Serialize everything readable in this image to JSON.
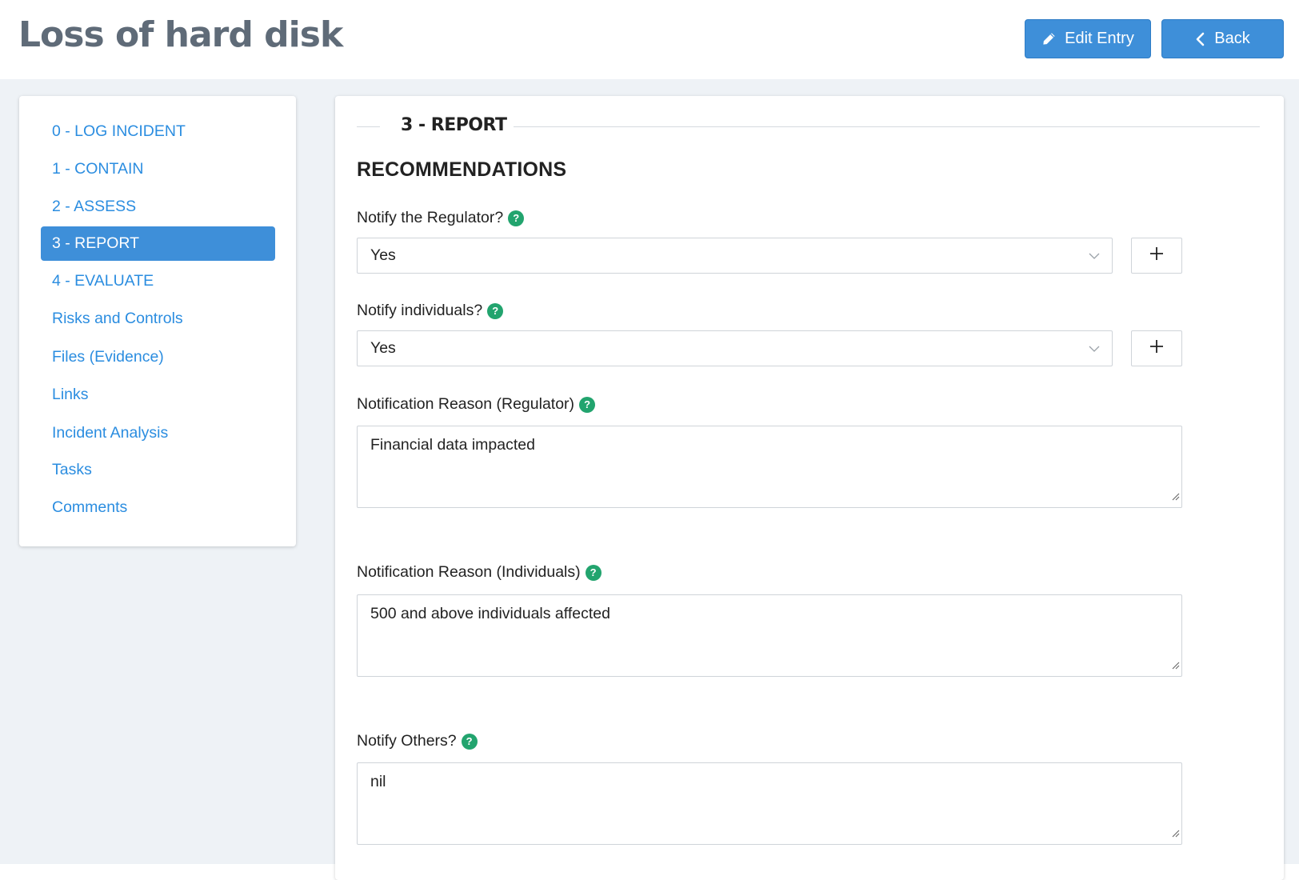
{
  "header": {
    "title": "Loss of hard disk",
    "edit_label": "Edit Entry",
    "back_label": "Back"
  },
  "sidebar": {
    "items": [
      {
        "label": "0 - LOG INCIDENT",
        "active": false
      },
      {
        "label": "1 - CONTAIN",
        "active": false
      },
      {
        "label": "2 - ASSESS",
        "active": false
      },
      {
        "label": "3 - REPORT",
        "active": true
      },
      {
        "label": "4 - EVALUATE",
        "active": false
      },
      {
        "label": "Risks and Controls",
        "active": false
      },
      {
        "label": "Files (Evidence)",
        "active": false
      },
      {
        "label": "Links",
        "active": false
      },
      {
        "label": "Incident Analysis",
        "active": false
      },
      {
        "label": "Tasks",
        "active": false
      },
      {
        "label": "Comments",
        "active": false
      }
    ]
  },
  "main": {
    "section_title": "3 - REPORT",
    "heading": "RECOMMENDATIONS",
    "fields": {
      "notify_regulator": {
        "label": "Notify the Regulator?",
        "value": "Yes"
      },
      "notify_individuals": {
        "label": "Notify individuals?",
        "value": "Yes"
      },
      "reason_regulator": {
        "label": "Notification Reason (Regulator)",
        "value": "Financial data impacted"
      },
      "reason_individuals": {
        "label": "Notification Reason (Individuals)",
        "value": "500 and above individuals affected"
      },
      "notify_others": {
        "label": "Notify Others?",
        "value": "nil"
      }
    },
    "help_glyph": "?",
    "plus_glyph": "+"
  },
  "colors": {
    "accent": "#3e8fd9",
    "link": "#2b8de0",
    "help": "#22a46e",
    "title": "#5f6b78",
    "background": "#eef2f6"
  },
  "icons": {
    "edit": "pencil-icon",
    "back": "chevron-left-icon",
    "help": "help-icon",
    "dropdown": "chevron-down-icon",
    "add": "plus-icon",
    "resize": "resize-grip-icon"
  }
}
